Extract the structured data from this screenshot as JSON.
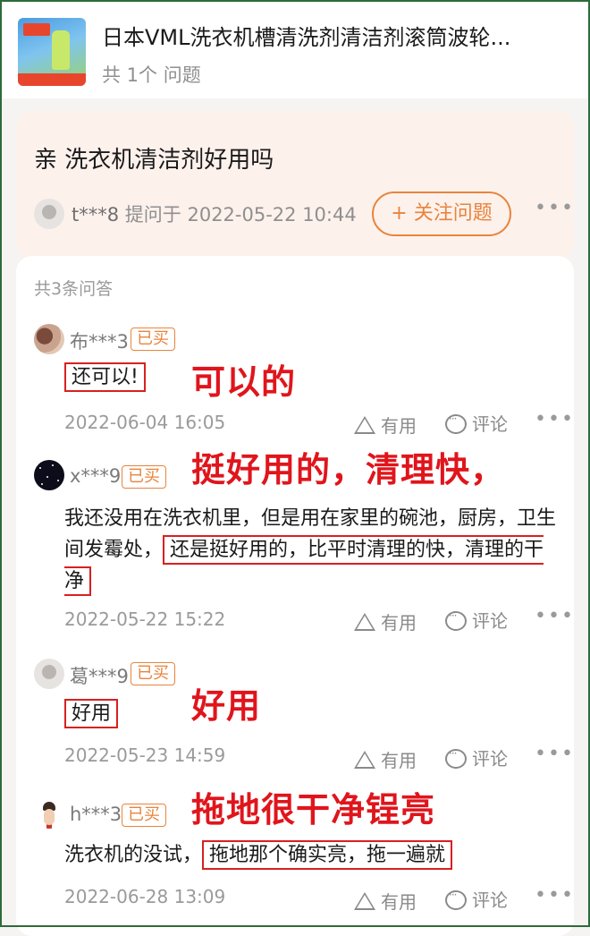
{
  "product": {
    "title": "日本VML洗衣机槽清洗剂清洁剂滚筒波轮...",
    "question_count": "共 1个 问题"
  },
  "question": {
    "title": "亲 洗衣机清洁剂好用吗",
    "asker": "t***8",
    "asked_at": "提问于 2022-05-22 10:44",
    "follow_label": "+ 关注问题",
    "more_icon": "more-icon"
  },
  "answers_header": "共3条问答",
  "bought_label": "已买",
  "useful_label": "有用",
  "comment_label": "评论",
  "answers": [
    {
      "user": "布***3",
      "text": "还可以!",
      "date": "2022-06-04 16:05",
      "annotation": "可以的"
    },
    {
      "user": "x***9",
      "text_plain": "我还没用在洗衣机里，但是用在家里的碗池，厨房，卫生间发霉处，",
      "text_boxed": "还是挺好用的，比平时清理的快，清理的干净",
      "date": "2022-05-22 15:22",
      "annotation": "挺好用的，清理快，"
    },
    {
      "user": "葛***9",
      "text": "好用",
      "date": "2022-05-23 14:59",
      "annotation": "好用"
    },
    {
      "user": "h***3",
      "text_plain": "洗衣机的没试，",
      "text_boxed": "拖地那个确实亮，拖一遍就",
      "date": "2022-06-28 13:09",
      "annotation": "拖地很干净锃亮"
    }
  ],
  "colors": {
    "accent": "#e8843c",
    "annotation_red": "#e0151c",
    "question_bg": "#fdf1ec"
  }
}
